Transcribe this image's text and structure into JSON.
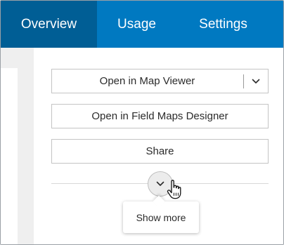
{
  "tabs": [
    {
      "label": "Overview",
      "active": true
    },
    {
      "label": "Usage",
      "active": false
    },
    {
      "label": "Settings",
      "active": false
    }
  ],
  "actions": {
    "open_map_viewer": "Open in Map Viewer",
    "open_field_maps": "Open in Field Maps Designer",
    "share": "Share"
  },
  "show_more": {
    "tooltip": "Show more"
  },
  "icons": {
    "dropdown": "chevron-down-icon",
    "expand": "chevron-down-icon",
    "cursor": "hand-pointer-icon"
  },
  "colors": {
    "tab_bar": "#0079c1",
    "tab_active": "#005e95"
  }
}
